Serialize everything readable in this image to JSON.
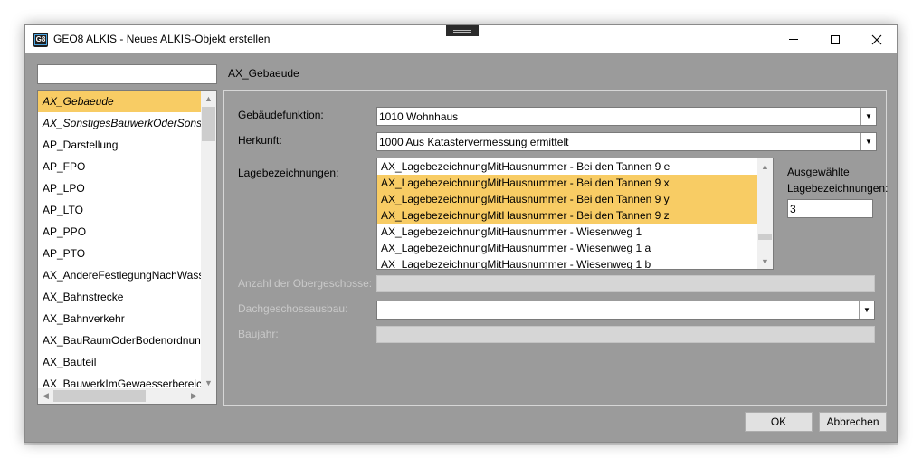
{
  "window": {
    "title": "GEO8 ALKIS - Neues ALKIS-Objekt erstellen",
    "icon_text": "G8"
  },
  "sidebar": {
    "search_value": "",
    "items": [
      {
        "label": "AX_Gebaeude",
        "selected": true
      },
      {
        "label": "AX_SonstigesBauwerkOderSonstigeEinrichtung",
        "italic": true
      },
      {
        "label": "AP_Darstellung"
      },
      {
        "label": "AP_FPO"
      },
      {
        "label": "AP_LPO"
      },
      {
        "label": "AP_LTO"
      },
      {
        "label": "AP_PPO"
      },
      {
        "label": "AP_PTO"
      },
      {
        "label": "AX_AndereFestlegungNachWasserrecht"
      },
      {
        "label": "AX_Bahnstrecke"
      },
      {
        "label": "AX_Bahnverkehr"
      },
      {
        "label": "AX_BauRaumOderBodenordnungsrecht"
      },
      {
        "label": "AX_Bauteil"
      },
      {
        "label": "AX_BauwerkImGewaesserbereich"
      }
    ]
  },
  "main": {
    "object_name": "AX_Gebaeude",
    "gebaeudefunktion": {
      "label": "Gebäudefunktion:",
      "value": "1010 Wohnhaus"
    },
    "herkunft": {
      "label": "Herkunft:",
      "value": "1000 Aus Katastervermessung ermittelt"
    },
    "lagebezeichnungen": {
      "label": "Lagebezeichnungen:",
      "items": [
        {
          "label": "AX_LagebezeichnungMitHausnummer - Bei den Tannen 9 e",
          "selected": false
        },
        {
          "label": "AX_LagebezeichnungMitHausnummer - Bei den Tannen 9 x",
          "selected": true
        },
        {
          "label": "AX_LagebezeichnungMitHausnummer - Bei den Tannen 9 y",
          "selected": true
        },
        {
          "label": "AX_LagebezeichnungMitHausnummer - Bei den Tannen 9 z",
          "selected": true
        },
        {
          "label": "AX_LagebezeichnungMitHausnummer - Wiesenweg 1",
          "selected": false
        },
        {
          "label": "AX_LagebezeichnungMitHausnummer - Wiesenweg 1 a",
          "selected": false
        },
        {
          "label": "AX_LagebezeichnungMitHausnummer - Wiesenweg 1 b",
          "selected": false
        }
      ],
      "selected_label_line1": "Ausgewählte",
      "selected_label_line2": "Lagebezeichnungen:",
      "selected_count": "3"
    },
    "obergeschosse_label": "Anzahl der Obergeschosse:",
    "dachgeschoss_label": "Dachgeschossausbau:",
    "dachgeschoss_value": "",
    "baujahr_label": "Baujahr:"
  },
  "buttons": {
    "ok": "OK",
    "cancel": "Abbrechen"
  },
  "colors": {
    "selection": "#f8cc64",
    "dialog_bg": "#9b9b9b"
  }
}
